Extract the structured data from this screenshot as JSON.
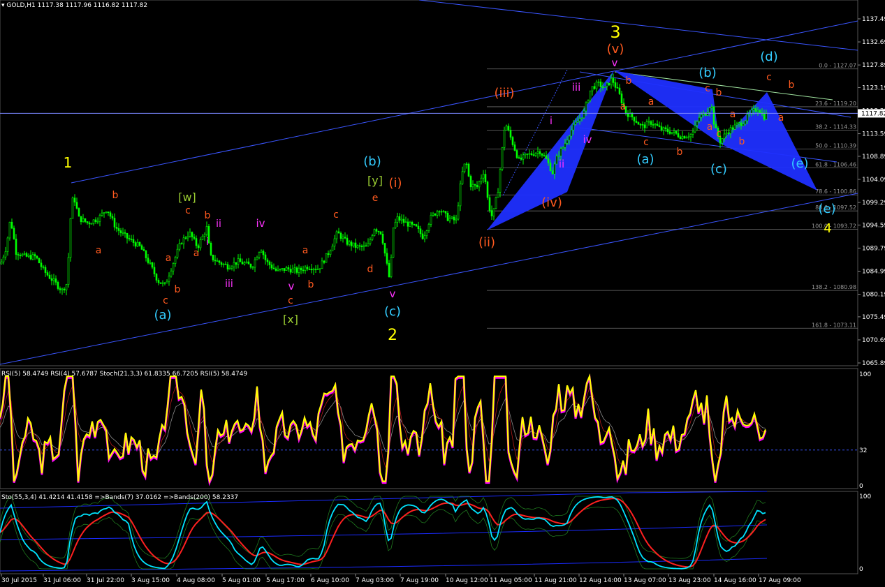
{
  "window": {
    "symbol_title": "GOLD,H1",
    "ohlc": "1117.38 1117.96 1116.82 1117.82",
    "current_price": "1117.82"
  },
  "indicators": {
    "rsi_title": "RSI(5) 58.4749  RSI(4) 57.6787  Stoch(21,3,3) 61.8335 66.7205  RSI(5) 58.4749",
    "sto_title": "Sto(55,3,4) 41.4214 41.4158  =>Bands(7) 37.0162  =>Bands(200) 58.2337",
    "rsi_levels": [
      "100",
      "32",
      "0"
    ],
    "sto_levels": [
      "100",
      "0"
    ]
  },
  "colors": {
    "background": "#000000",
    "candle": "#00ff00",
    "channel": "#3a55ff",
    "pattern_fill": "#1f2fff",
    "fib": "#6e6e6e",
    "rsi_main": "#ffff00",
    "rsi_shadow": "#ff00ff",
    "sto_main": "#00e5ff",
    "sto_signal": "#ff2020",
    "bands": "#1a2bff"
  },
  "chart_data": {
    "type": "candlestick",
    "symbol": "GOLD",
    "timeframe": "H1",
    "ylim": [
      1065.89,
      1139.5
    ],
    "y_ticks": [
      "1137.49",
      "1132.69",
      "1127.89",
      "1123.19",
      "1118.39",
      "1113.59",
      "1108.89",
      "1104.09",
      "1099.29",
      "1094.59",
      "1089.79",
      "1084.99",
      "1080.19",
      "1075.49",
      "1070.69",
      "1065.89"
    ],
    "x_ticks": [
      "30 Jul 2015",
      "31 Jul 06:00",
      "31 Jul 22:00",
      "3 Aug 15:00",
      "4 Aug 08:00",
      "5 Aug 01:00",
      "5 Aug 17:00",
      "6 Aug 10:00",
      "7 Aug 03:00",
      "7 Aug 19:00",
      "10 Aug 12:00",
      "11 Aug 05:00",
      "11 Aug 21:00",
      "12 Aug 14:00",
      "13 Aug 07:00",
      "13 Aug 23:00",
      "14 Aug 16:00",
      "17 Aug 09:00"
    ],
    "price_path": [
      [
        0,
        1086.5
      ],
      [
        8,
        1090
      ],
      [
        14,
        1096
      ],
      [
        22,
        1089
      ],
      [
        35,
        1088
      ],
      [
        50,
        1088
      ],
      [
        62,
        1085
      ],
      [
        75,
        1083
      ],
      [
        88,
        1081
      ],
      [
        95,
        1082.5
      ],
      [
        100,
        1096
      ],
      [
        104,
        1101
      ],
      [
        112,
        1096
      ],
      [
        125,
        1095
      ],
      [
        140,
        1096
      ],
      [
        152,
        1098
      ],
      [
        165,
        1094
      ],
      [
        180,
        1092
      ],
      [
        200,
        1090
      ],
      [
        215,
        1086
      ],
      [
        225,
        1083
      ],
      [
        235,
        1082
      ],
      [
        245,
        1086
      ],
      [
        258,
        1091
      ],
      [
        270,
        1093
      ],
      [
        282,
        1090
      ],
      [
        295,
        1094
      ],
      [
        300,
        1088
      ],
      [
        310,
        1087
      ],
      [
        325,
        1086
      ],
      [
        340,
        1087
      ],
      [
        360,
        1086
      ],
      [
        372,
        1090
      ],
      [
        380,
        1087
      ],
      [
        395,
        1085
      ],
      [
        410,
        1085.5
      ],
      [
        425,
        1085
      ],
      [
        440,
        1086
      ],
      [
        455,
        1085.5
      ],
      [
        470,
        1089
      ],
      [
        482,
        1093
      ],
      [
        495,
        1091
      ],
      [
        510,
        1090
      ],
      [
        525,
        1090
      ],
      [
        535,
        1094
      ],
      [
        545,
        1093
      ],
      [
        552,
        1087
      ],
      [
        557,
        1083
      ],
      [
        562,
        1094
      ],
      [
        568,
        1096
      ],
      [
        580,
        1095
      ],
      [
        595,
        1094
      ],
      [
        605,
        1092
      ],
      [
        615,
        1096
      ],
      [
        628,
        1098
      ],
      [
        640,
        1096
      ],
      [
        652,
        1095.5
      ],
      [
        660,
        1105
      ],
      [
        666,
        1108
      ],
      [
        672,
        1103
      ],
      [
        682,
        1102.5
      ],
      [
        692,
        1106
      ],
      [
        698,
        1099
      ],
      [
        704,
        1096
      ],
      [
        712,
        1102
      ],
      [
        722,
        1116
      ],
      [
        732,
        1112
      ],
      [
        742,
        1108
      ],
      [
        752,
        1109
      ],
      [
        762,
        1109.5
      ],
      [
        772,
        1110
      ],
      [
        782,
        1108
      ],
      [
        790,
        1105.5
      ],
      [
        797,
        1109
      ],
      [
        806,
        1111
      ],
      [
        815,
        1114
      ],
      [
        825,
        1116
      ],
      [
        835,
        1118
      ],
      [
        845,
        1123
      ],
      [
        855,
        1124
      ],
      [
        865,
        1123
      ],
      [
        875,
        1125
      ],
      [
        885,
        1122
      ],
      [
        895,
        1118
      ],
      [
        905,
        1117
      ],
      [
        918,
        1115
      ],
      [
        932,
        1116
      ],
      [
        945,
        1114.5
      ],
      [
        960,
        1114
      ],
      [
        975,
        1113
      ],
      [
        990,
        1113.5
      ],
      [
        1000,
        1117
      ],
      [
        1010,
        1118
      ],
      [
        1017,
        1120
      ],
      [
        1022,
        1115
      ],
      [
        1030,
        1112
      ],
      [
        1040,
        1114
      ],
      [
        1050,
        1115
      ],
      [
        1062,
        1116
      ],
      [
        1075,
        1118
      ],
      [
        1085,
        1119
      ],
      [
        1092,
        1117
      ],
      [
        1097,
        1117.8
      ]
    ],
    "fibonacci_levels": [
      {
        "label": "0.0 - 1127.07",
        "price": 1127.07
      },
      {
        "label": "23.6 - 1119.20",
        "price": 1119.2
      },
      {
        "label": "38.2 - 1114.33",
        "price": 1114.33
      },
      {
        "label": "50.0 - 1110.39",
        "price": 1110.39
      },
      {
        "label": "61.8 - 1106.46",
        "price": 1106.46
      },
      {
        "label": "78.6 - 1100.86",
        "price": 1100.86
      },
      {
        "label": "88.6 - 1097.52",
        "price": 1097.52
      },
      {
        "label": "100.0 - 1093.72",
        "price": 1093.72
      },
      {
        "label": "138.2 - 1080.98",
        "price": 1080.98
      },
      {
        "label": "161.8 - 1073.11",
        "price": 1073.11
      }
    ],
    "wave_labels": [
      {
        "text": "1",
        "color": "#ffff00"
      },
      {
        "text": "b",
        "color": "#ff5a1f"
      },
      {
        "text": "a",
        "color": "#ff5a1f"
      },
      {
        "text": "[w]",
        "color": "#9acd32"
      },
      {
        "text": "c",
        "color": "#ff5a1f"
      },
      {
        "text": "b",
        "color": "#ff5a1f"
      },
      {
        "text": "ii",
        "color": "#ff33ff"
      },
      {
        "text": "a",
        "color": "#ff5a1f"
      },
      {
        "text": "i",
        "color": "#ff33ff"
      },
      {
        "text": "a",
        "color": "#ff5a1f"
      },
      {
        "text": "b",
        "color": "#ff5a1f"
      },
      {
        "text": "c",
        "color": "#ff5a1f"
      },
      {
        "text": "(a)",
        "color": "#33ccff"
      },
      {
        "text": "iii",
        "color": "#ff33ff"
      },
      {
        "text": "iv",
        "color": "#ff33ff"
      },
      {
        "text": "v",
        "color": "#ff33ff"
      },
      {
        "text": "c",
        "color": "#ff5a1f"
      },
      {
        "text": "[x]",
        "color": "#9acd32"
      },
      {
        "text": "a",
        "color": "#ff5a1f"
      },
      {
        "text": "b",
        "color": "#ff5a1f"
      },
      {
        "text": "c",
        "color": "#ff5a1f"
      },
      {
        "text": "d",
        "color": "#ff5a1f"
      },
      {
        "text": "e",
        "color": "#ff5a1f"
      },
      {
        "text": "(b)",
        "color": "#33ccff"
      },
      {
        "text": "[y]",
        "color": "#9acd32"
      },
      {
        "text": "(i)",
        "color": "#ff5a1f"
      },
      {
        "text": "v",
        "color": "#ff33ff"
      },
      {
        "text": "(c)",
        "color": "#33ccff"
      },
      {
        "text": "2",
        "color": "#ffff00"
      },
      {
        "text": "(ii)",
        "color": "#ff5a1f"
      },
      {
        "text": "(iii)",
        "color": "#ff5a1f"
      },
      {
        "text": "i",
        "color": "#ff33ff"
      },
      {
        "text": "ii",
        "color": "#ff33ff"
      },
      {
        "text": "iii",
        "color": "#ff33ff"
      },
      {
        "text": "iv",
        "color": "#ff33ff"
      },
      {
        "text": "(iv)",
        "color": "#ff5a1f"
      },
      {
        "text": "3",
        "color": "#ffff00"
      },
      {
        "text": "(v)",
        "color": "#ff5a1f"
      },
      {
        "text": "v",
        "color": "#ff33ff"
      },
      {
        "text": "b",
        "color": "#ff5a1f"
      },
      {
        "text": "a",
        "color": "#ff5a1f"
      },
      {
        "text": "a",
        "color": "#ff5a1f"
      },
      {
        "text": "c",
        "color": "#ff5a1f"
      },
      {
        "text": "(a)",
        "color": "#33ccff"
      },
      {
        "text": "b",
        "color": "#ff5a1f"
      },
      {
        "text": "(b)",
        "color": "#33ccff"
      },
      {
        "text": "c",
        "color": "#ff5a1f"
      },
      {
        "text": "b",
        "color": "#ff5a1f"
      },
      {
        "text": "a",
        "color": "#ff5a1f"
      },
      {
        "text": "a",
        "color": "#ff5a1f"
      },
      {
        "text": "c",
        "color": "#ff5a1f"
      },
      {
        "text": "(c)",
        "color": "#33ccff"
      },
      {
        "text": "b",
        "color": "#ff5a1f"
      },
      {
        "text": "(d)",
        "color": "#33ccff"
      },
      {
        "text": "c",
        "color": "#ff5a1f"
      },
      {
        "text": "b",
        "color": "#ff5a1f"
      },
      {
        "text": "a",
        "color": "#ff5a1f"
      },
      {
        "text": "(e)",
        "color": "#33ccff"
      },
      {
        "text": "(e)",
        "color": "#33ccff"
      },
      {
        "text": "4",
        "color": "#ffff00"
      }
    ]
  }
}
